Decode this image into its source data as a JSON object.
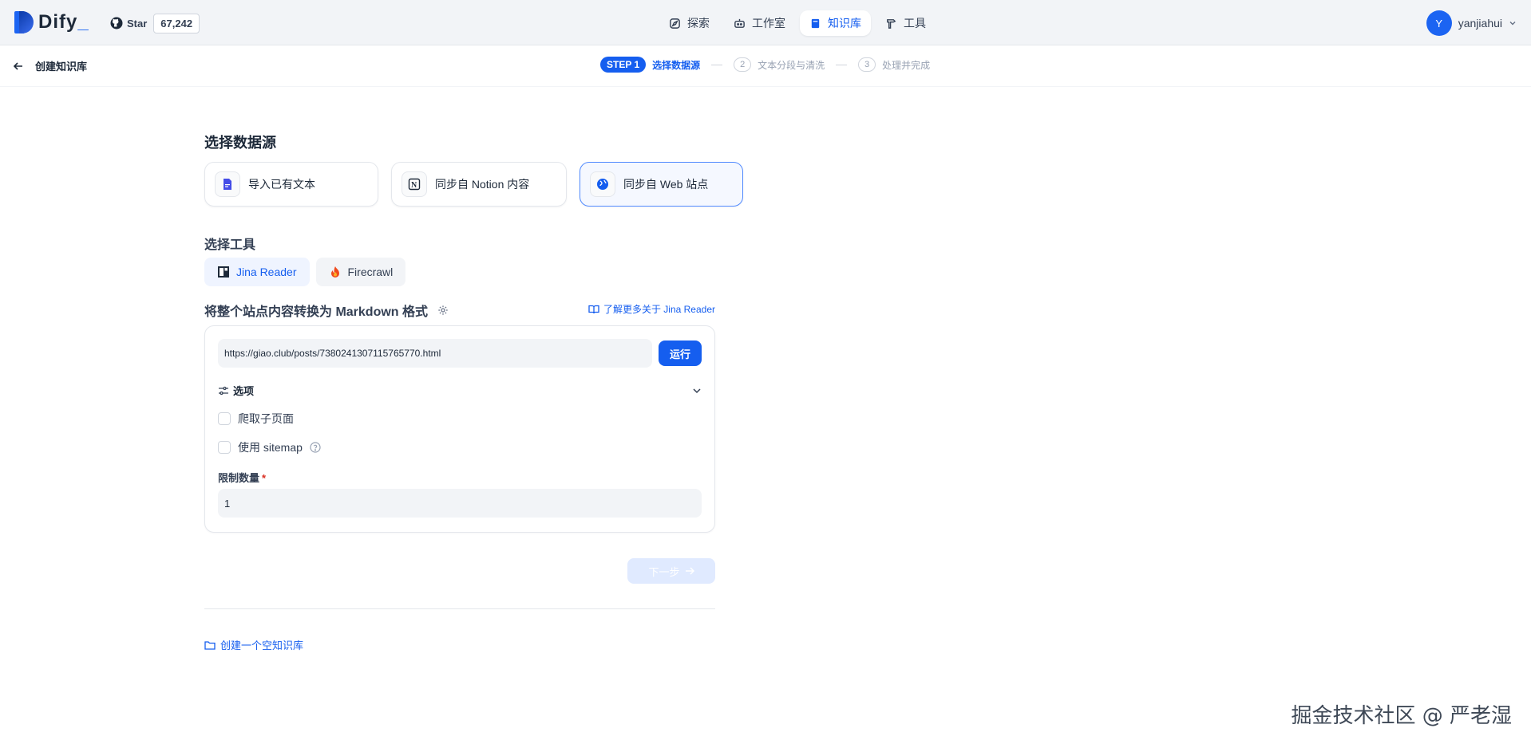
{
  "app": {
    "logo_text": "Dify",
    "logo_suffix": "_"
  },
  "github": {
    "star_label": "Star",
    "count": "67,242"
  },
  "nav": [
    {
      "label": "探索",
      "icon": "compass-icon"
    },
    {
      "label": "工作室",
      "icon": "robot-icon"
    },
    {
      "label": "知识库",
      "icon": "book-icon",
      "active": true
    },
    {
      "label": "工具",
      "icon": "hammer-icon"
    }
  ],
  "user": {
    "initial": "Y",
    "name": "yanjiahui"
  },
  "subheader": {
    "back_label": "创建知识库",
    "step1_badge": "STEP 1",
    "step1_label": "选择数据源",
    "step2_num": "2",
    "step2_label": "文本分段与清洗",
    "step3_num": "3",
    "step3_label": "处理并完成"
  },
  "datasource": {
    "title": "选择数据源",
    "options": [
      {
        "label": "导入已有文本",
        "icon": "file-icon"
      },
      {
        "label": "同步自 Notion 内容",
        "icon": "notion-icon"
      },
      {
        "label": "同步自 Web 站点",
        "icon": "globe-icon",
        "active": true
      }
    ]
  },
  "tools": {
    "title": "选择工具",
    "items": [
      {
        "label": "Jina Reader",
        "icon": "jina-icon",
        "active": true
      },
      {
        "label": "Firecrawl",
        "icon": "fire-icon"
      }
    ]
  },
  "crawler": {
    "title": "将整个站点内容转换为 Markdown 格式",
    "learn_more": "了解更多关于 Jina Reader",
    "url_value": "https://giao.club/posts/7380241307115765770.html",
    "run_label": "运行",
    "options_label": "选项",
    "crawl_subpages": "爬取子页面",
    "use_sitemap": "使用 sitemap",
    "limit_label": "限制数量",
    "limit_required": "*",
    "limit_value": "1"
  },
  "actions": {
    "next_label": "下一步",
    "empty_kb": "创建一个空知识库"
  },
  "watermark": "掘金技术社区 @ 严老湿",
  "colors": {
    "accent": "#155eef",
    "border": "#e4e7ec",
    "muted": "#98a2b3"
  }
}
